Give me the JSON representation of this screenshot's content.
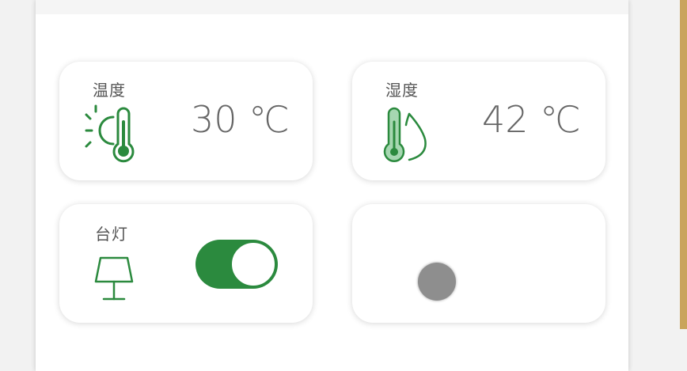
{
  "cards": {
    "temperature": {
      "label": "温度",
      "value": "30 ℃",
      "icon": "sun-thermometer-icon"
    },
    "humidity": {
      "label": "湿度",
      "value": "42 ℃",
      "icon": "humidity-thermometer-icon"
    },
    "lamp": {
      "label": "台灯",
      "icon": "lamp-icon",
      "toggle_on": true
    },
    "blank": {
      "indicator": "gray-dot"
    }
  },
  "colors": {
    "accent": "#2b8a3e",
    "value_text": "#666666",
    "label_text": "#555555",
    "dot": "#8e8e8e",
    "side_edge": "#c9a45c"
  }
}
